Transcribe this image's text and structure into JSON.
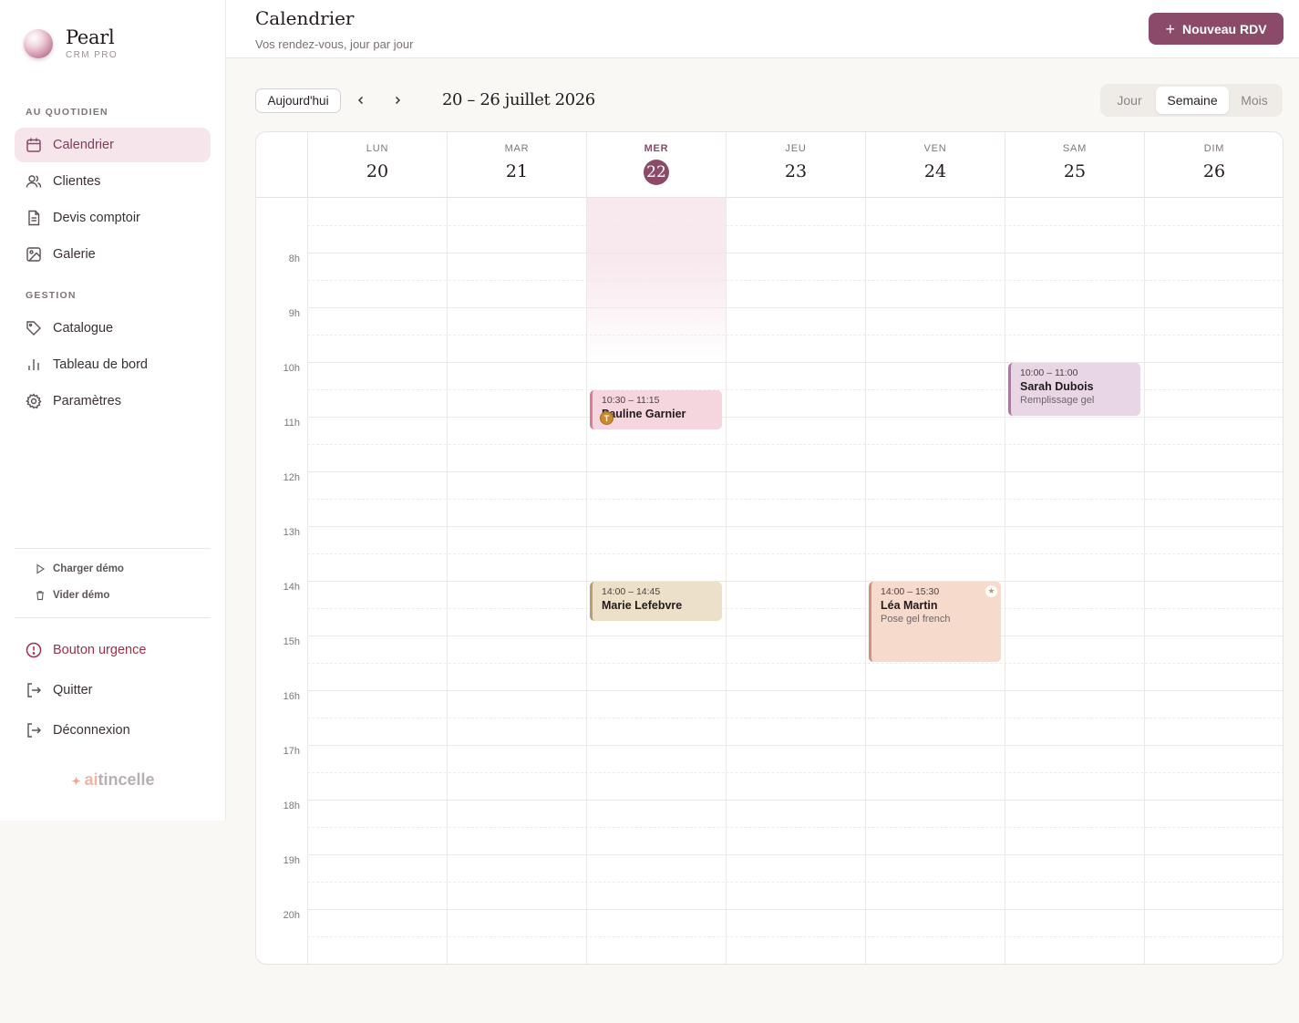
{
  "brand": {
    "name": "Pearl",
    "subtitle": "CRM PRO"
  },
  "sidebar": {
    "section_daily": "AU QUOTIDIEN",
    "daily_items": [
      {
        "label": "Calendrier",
        "icon": "calendar-icon",
        "active": true
      },
      {
        "label": "Clientes",
        "icon": "users-icon"
      },
      {
        "label": "Devis comptoir",
        "icon": "document-icon"
      },
      {
        "label": "Galerie",
        "icon": "image-icon"
      }
    ],
    "section_manage": "GESTION",
    "manage_items": [
      {
        "label": "Catalogue",
        "icon": "tag-icon"
      },
      {
        "label": "Tableau de bord",
        "icon": "bar-chart-icon"
      },
      {
        "label": "Paramètres",
        "icon": "gear-icon"
      }
    ],
    "load_demo": "Charger démo",
    "clear_demo": "Vider démo",
    "urgent": "Bouton urgence",
    "quit": "Quitter",
    "logout": "Déconnexion",
    "footer_brand_ai": "ai",
    "footer_brand_rest": "tincelle"
  },
  "header": {
    "title": "Calendrier",
    "subtitle": "Vos rendez-vous, jour par jour",
    "new_button": "Nouveau RDV"
  },
  "toolbar": {
    "today": "Aujourd'hui",
    "range": "20 – 26 juillet 2026",
    "views": [
      "Jour",
      "Semaine",
      "Mois"
    ],
    "active_view": "Semaine"
  },
  "calendar": {
    "days": [
      {
        "name": "LUN",
        "num": "20"
      },
      {
        "name": "MAR",
        "num": "21"
      },
      {
        "name": "MER",
        "num": "22",
        "today": true
      },
      {
        "name": "JEU",
        "num": "23"
      },
      {
        "name": "VEN",
        "num": "24"
      },
      {
        "name": "SAM",
        "num": "25"
      },
      {
        "name": "DIM",
        "num": "26"
      }
    ],
    "hours": [
      "8h",
      "9h",
      "10h",
      "11h",
      "12h",
      "13h",
      "14h",
      "15h",
      "16h",
      "17h",
      "18h",
      "19h",
      "20h"
    ],
    "events": [
      {
        "day": 2,
        "start": "10:30",
        "end": "11:15",
        "time": "10:30 – 11:15",
        "name": "Pauline Garnier",
        "service": "",
        "style": "pink",
        "badge": "T"
      },
      {
        "day": 2,
        "start": "14:00",
        "end": "14:45",
        "time": "14:00 – 14:45",
        "name": "Marie Lefebvre",
        "service": "",
        "style": "sand"
      },
      {
        "day": 4,
        "start": "14:00",
        "end": "15:30",
        "time": "14:00 – 15:30",
        "name": "Léa Martin",
        "service": "Pose gel french",
        "style": "peach",
        "star": true
      },
      {
        "day": 5,
        "start": "10:00",
        "end": "11:00",
        "time": "10:00 – 11:00",
        "name": "Sarah Dubois",
        "service": "Remplissage gel",
        "style": "lilac"
      }
    ]
  },
  "colors": {
    "accent": "#8a4a68",
    "today_shade": "#f8e9ee"
  }
}
